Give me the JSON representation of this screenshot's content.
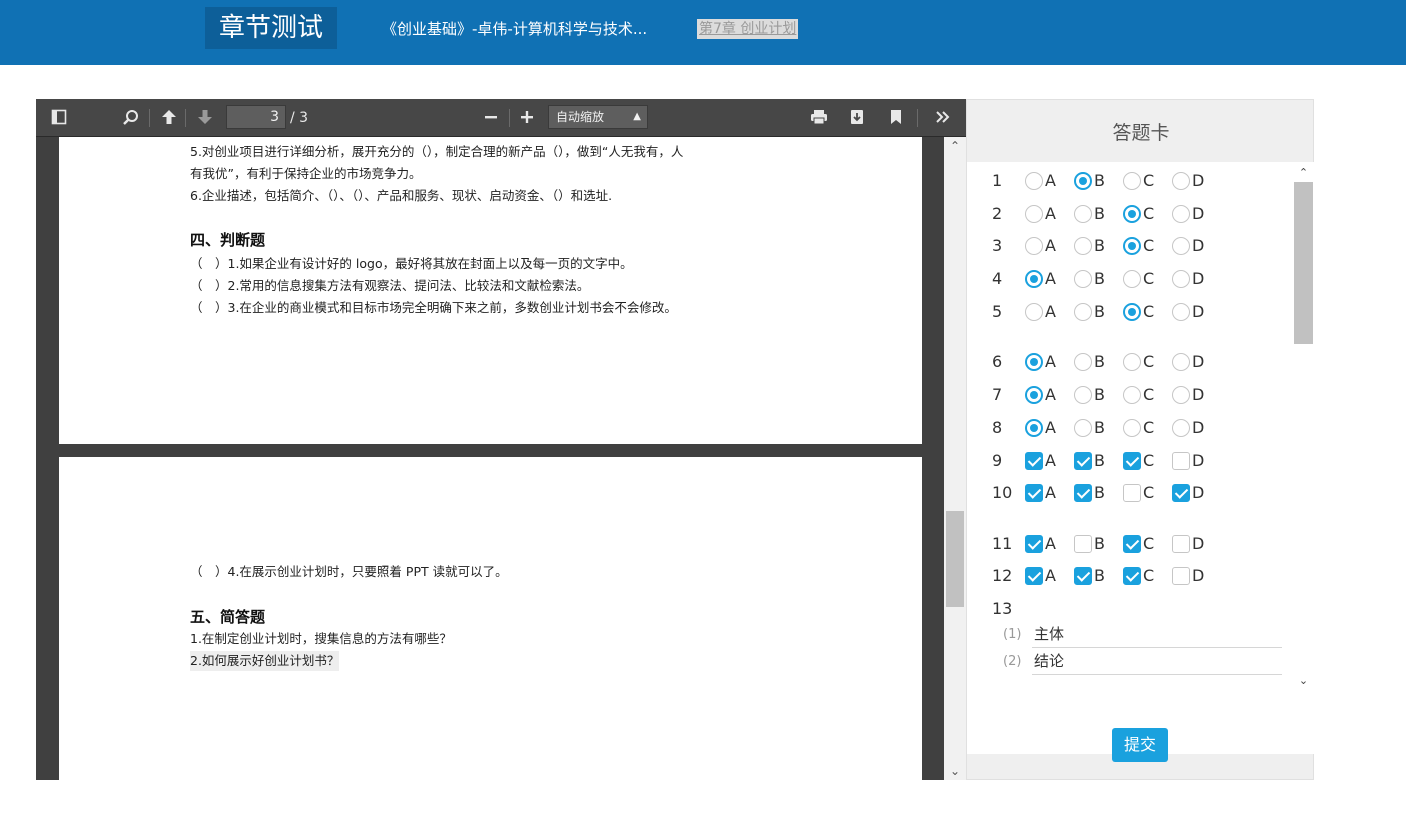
{
  "header": {
    "title": "章节测试",
    "course": "《创业基础》-卓伟-计算机科学与技术...",
    "chapter": "第7章 创业计划"
  },
  "pdf": {
    "page_current": "3",
    "page_total": "/ 3",
    "zoom": "自动缩放",
    "page1_lines": [
      "5.对创业项目进行详细分析，展开充分的（），制定合理的新产品（），做到“人无我有，人",
      "有我优”，有利于保持企业的市场竞争力。",
      "6.企业描述，包括简介、（）、（）、产品和服务、现状、启动资金、（）和选址.",
      "四、判断题",
      "（　）1.如果企业有设计好的 logo，最好将其放在封面上以及每一页的文字中。",
      "（　）2.常用的信息搜集方法有观察法、提问法、比较法和文献检索法。",
      "（　）3.在企业的商业模式和目标市场完全明确下来之前，多数创业计划书会不会修改。"
    ],
    "page2_lines": [
      "（　）4.在展示创业计划时，只要照着 PPT 读就可以了。",
      "五、简答题",
      "1.在制定创业计划时，搜集信息的方法有哪些？",
      "2.如何展示好创业计划书？"
    ]
  },
  "answer_card": {
    "title": "答题卡",
    "submit_label": "提交",
    "questions": [
      {
        "num": "1",
        "type": "radio",
        "options": [
          "A",
          "B",
          "C",
          "D"
        ],
        "selected": [
          "B"
        ]
      },
      {
        "num": "2",
        "type": "radio",
        "options": [
          "A",
          "B",
          "C",
          "D"
        ],
        "selected": [
          "C"
        ]
      },
      {
        "num": "3",
        "type": "radio",
        "options": [
          "A",
          "B",
          "C",
          "D"
        ],
        "selected": [
          "C"
        ]
      },
      {
        "num": "4",
        "type": "radio",
        "options": [
          "A",
          "B",
          "C",
          "D"
        ],
        "selected": [
          "A"
        ]
      },
      {
        "num": "5",
        "type": "radio",
        "options": [
          "A",
          "B",
          "C",
          "D"
        ],
        "selected": [
          "C"
        ]
      },
      {
        "num": "6",
        "type": "radio",
        "options": [
          "A",
          "B",
          "C",
          "D"
        ],
        "selected": [
          "A"
        ]
      },
      {
        "num": "7",
        "type": "radio",
        "options": [
          "A",
          "B",
          "C",
          "D"
        ],
        "selected": [
          "A"
        ]
      },
      {
        "num": "8",
        "type": "radio",
        "options": [
          "A",
          "B",
          "C",
          "D"
        ],
        "selected": [
          "A"
        ]
      },
      {
        "num": "9",
        "type": "check",
        "options": [
          "A",
          "B",
          "C",
          "D"
        ],
        "selected": [
          "A",
          "B",
          "C"
        ]
      },
      {
        "num": "10",
        "type": "check",
        "options": [
          "A",
          "B",
          "C",
          "D"
        ],
        "selected": [
          "A",
          "B",
          "D"
        ]
      },
      {
        "num": "11",
        "type": "check",
        "options": [
          "A",
          "B",
          "C",
          "D"
        ],
        "selected": [
          "A",
          "C"
        ]
      },
      {
        "num": "12",
        "type": "check",
        "options": [
          "A",
          "B",
          "C",
          "D"
        ],
        "selected": [
          "A",
          "B",
          "C"
        ]
      }
    ],
    "fill_question": {
      "num": "13",
      "blanks": [
        {
          "idx": "(1)",
          "value": "主体"
        },
        {
          "idx": "(2)",
          "value": "结论"
        }
      ]
    }
  },
  "colors": {
    "header_bg": "#1071b4",
    "accent": "#1aa1de"
  }
}
